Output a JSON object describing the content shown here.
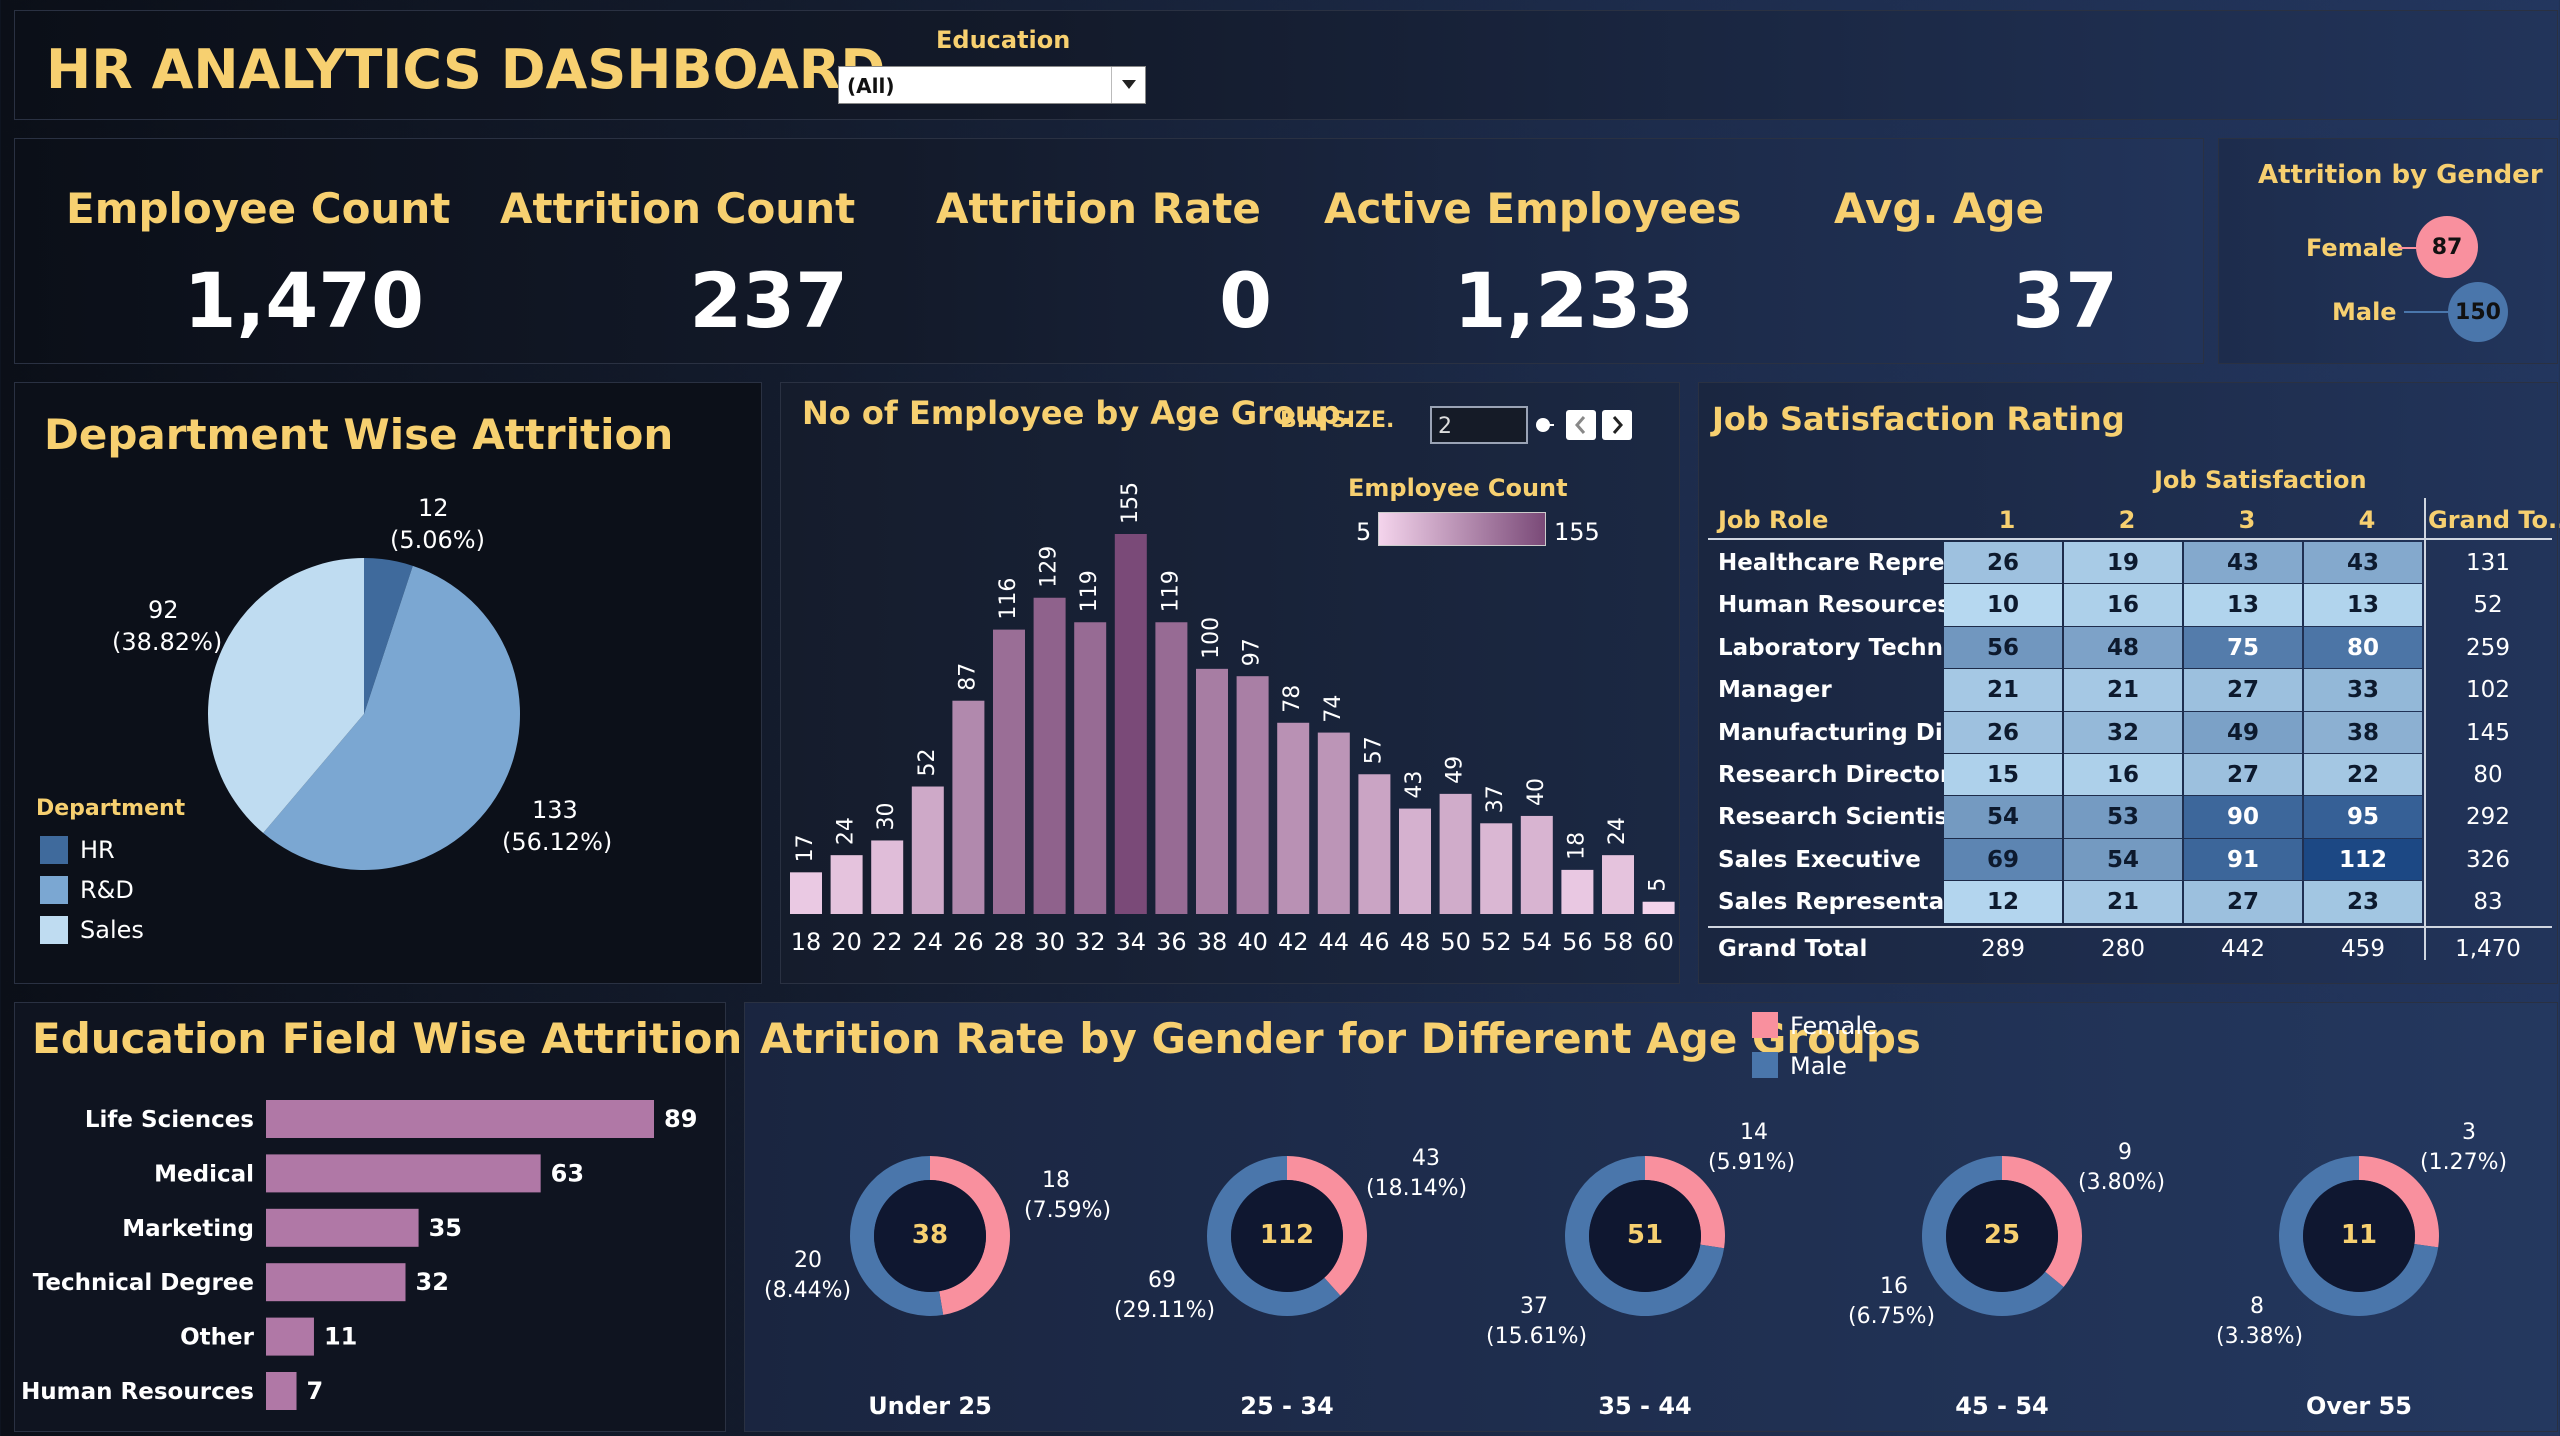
{
  "header": {
    "title": "HR ANALYTICS DASHBOARD",
    "filter_label": "Education",
    "filter_value": "(All)"
  },
  "kpis": [
    {
      "label": "Employee Count",
      "value": "1,470"
    },
    {
      "label": "Attrition Count",
      "value": "237"
    },
    {
      "label": "Attrition Rate",
      "value": "0"
    },
    {
      "label": "Active Employees",
      "value": "1,233"
    },
    {
      "label": "Avg. Age",
      "value": "37"
    }
  ],
  "gender_panel": {
    "title": "Attrition by Gender",
    "female_label": "Female",
    "female_value": "87",
    "male_label": "Male",
    "male_value": "150"
  },
  "colors": {
    "gold": "#f7d070",
    "hr": "#3f6a9c",
    "rd": "#7ba7d2",
    "sales": "#bfdcf1",
    "female": "#f9909e",
    "male": "#4a76ab",
    "bar_purple": "#b078a6"
  },
  "department": {
    "title": "Department Wise Attrition",
    "legend_title": "Department",
    "labels": {
      "hr_count": "12",
      "hr_pct": "(5.06%)",
      "rd_count": "133",
      "rd_pct": "(56.12%)",
      "sales_count": "92",
      "sales_pct": "(38.82%)"
    },
    "legend": [
      "HR",
      "R&D",
      "Sales"
    ]
  },
  "age_group": {
    "title": "No of Employee by Age Group.",
    "bin_label": "BIN SIZE.",
    "bin_value": "2",
    "legend_title": "Employee Count",
    "legend_min": "5",
    "legend_max": "155"
  },
  "job_satisfaction": {
    "title": "Job Satisfaction Rating",
    "col_group": "Job Satisfaction",
    "role_header": "Job Role",
    "columns": [
      "1",
      "2",
      "3",
      "4"
    ],
    "total_header": "Grand To..",
    "rows": [
      {
        "role": "Healthcare Repres..",
        "v": [
          "26",
          "19",
          "43",
          "43"
        ],
        "total": "131"
      },
      {
        "role": "Human Resources",
        "v": [
          "10",
          "16",
          "13",
          "13"
        ],
        "total": "52"
      },
      {
        "role": "Laboratory Techni..",
        "v": [
          "56",
          "48",
          "75",
          "80"
        ],
        "total": "259"
      },
      {
        "role": "Manager",
        "v": [
          "21",
          "21",
          "27",
          "33"
        ],
        "total": "102"
      },
      {
        "role": "Manufacturing Dir..",
        "v": [
          "26",
          "32",
          "49",
          "38"
        ],
        "total": "145"
      },
      {
        "role": "Research Director",
        "v": [
          "15",
          "16",
          "27",
          "22"
        ],
        "total": "80"
      },
      {
        "role": "Research Scientist",
        "v": [
          "54",
          "53",
          "90",
          "95"
        ],
        "total": "292"
      },
      {
        "role": "Sales Executive",
        "v": [
          "69",
          "54",
          "91",
          "112"
        ],
        "total": "326"
      },
      {
        "role": "Sales Representati..",
        "v": [
          "12",
          "21",
          "27",
          "23"
        ],
        "total": "83"
      }
    ],
    "grand_total": {
      "label": "Grand Total",
      "v": [
        "289",
        "280",
        "442",
        "459"
      ],
      "total": "1,470"
    }
  },
  "education_field": {
    "title": "Education Field  Wise Attrition"
  },
  "gender_age": {
    "title": "Atrition Rate by  Gender for Different Age Groups",
    "legend": [
      "Female",
      "Male"
    ],
    "groups": [
      {
        "name": "Under 25",
        "total": "38",
        "female": "18",
        "female_pct": "(7.59%)",
        "male": "20",
        "male_pct": "(8.44%)"
      },
      {
        "name": "25 - 34",
        "total": "112",
        "female": "43",
        "female_pct": "(18.14%)",
        "male": "69",
        "male_pct": "(29.11%)"
      },
      {
        "name": "35 - 44",
        "total": "51",
        "female": "14",
        "female_pct": "(5.91%)",
        "male": "37",
        "male_pct": "(15.61%)"
      },
      {
        "name": "45 - 54",
        "total": "25",
        "female": "9",
        "female_pct": "(3.80%)",
        "male": "16",
        "male_pct": "(6.75%)"
      },
      {
        "name": "Over 55",
        "total": "11",
        "female": "3",
        "female_pct": "(1.27%)",
        "male": "8",
        "male_pct": "(3.38%)"
      }
    ]
  },
  "chart_data": [
    {
      "type": "pie",
      "title": "Department Wise Attrition",
      "categories": [
        "HR",
        "R&D",
        "Sales"
      ],
      "values": [
        12,
        133,
        92
      ],
      "percentages": [
        5.06,
        56.12,
        38.82
      ],
      "legend_position": "left"
    },
    {
      "type": "bar",
      "title": "No of Employee by Age Group.",
      "categories": [
        "18",
        "20",
        "22",
        "24",
        "26",
        "28",
        "30",
        "32",
        "34",
        "36",
        "38",
        "40",
        "42",
        "44",
        "46",
        "48",
        "50",
        "52",
        "54",
        "56",
        "58",
        "60"
      ],
      "values": [
        17,
        24,
        30,
        52,
        87,
        116,
        129,
        119,
        155,
        119,
        100,
        97,
        78,
        74,
        57,
        43,
        49,
        37,
        40,
        18,
        24,
        5
      ],
      "color_range": [
        5,
        155
      ],
      "grid": false
    },
    {
      "type": "heatmap",
      "title": "Job Satisfaction Rating",
      "x": [
        "1",
        "2",
        "3",
        "4"
      ],
      "y": [
        "Healthcare Repres..",
        "Human Resources",
        "Laboratory Techni..",
        "Manager",
        "Manufacturing Dir..",
        "Research Director",
        "Research Scientist",
        "Sales Executive",
        "Sales Representati.."
      ],
      "values": [
        [
          26,
          19,
          43,
          43
        ],
        [
          10,
          16,
          13,
          13
        ],
        [
          56,
          48,
          75,
          80
        ],
        [
          21,
          21,
          27,
          33
        ],
        [
          26,
          32,
          49,
          38
        ],
        [
          15,
          16,
          27,
          22
        ],
        [
          54,
          53,
          90,
          95
        ],
        [
          69,
          54,
          91,
          112
        ],
        [
          12,
          21,
          27,
          23
        ]
      ]
    },
    {
      "type": "bar",
      "orientation": "horizontal",
      "title": "Education Field  Wise Attrition",
      "categories": [
        "Life Sciences",
        "Medical",
        "Marketing",
        "Technical Degree",
        "Other",
        "Human Resources"
      ],
      "values": [
        89,
        63,
        35,
        32,
        11,
        7
      ]
    },
    {
      "type": "pie",
      "subtype": "donut",
      "title": "Atrition Rate by  Gender for Different Age Groups",
      "categories": [
        "Under 25",
        "25 - 34",
        "35 - 44",
        "45 - 54",
        "Over 55"
      ],
      "series": [
        {
          "name": "Female",
          "values": [
            18,
            43,
            14,
            9,
            3
          ]
        },
        {
          "name": "Male",
          "values": [
            20,
            69,
            37,
            16,
            8
          ]
        }
      ],
      "legend_position": "top"
    }
  ]
}
